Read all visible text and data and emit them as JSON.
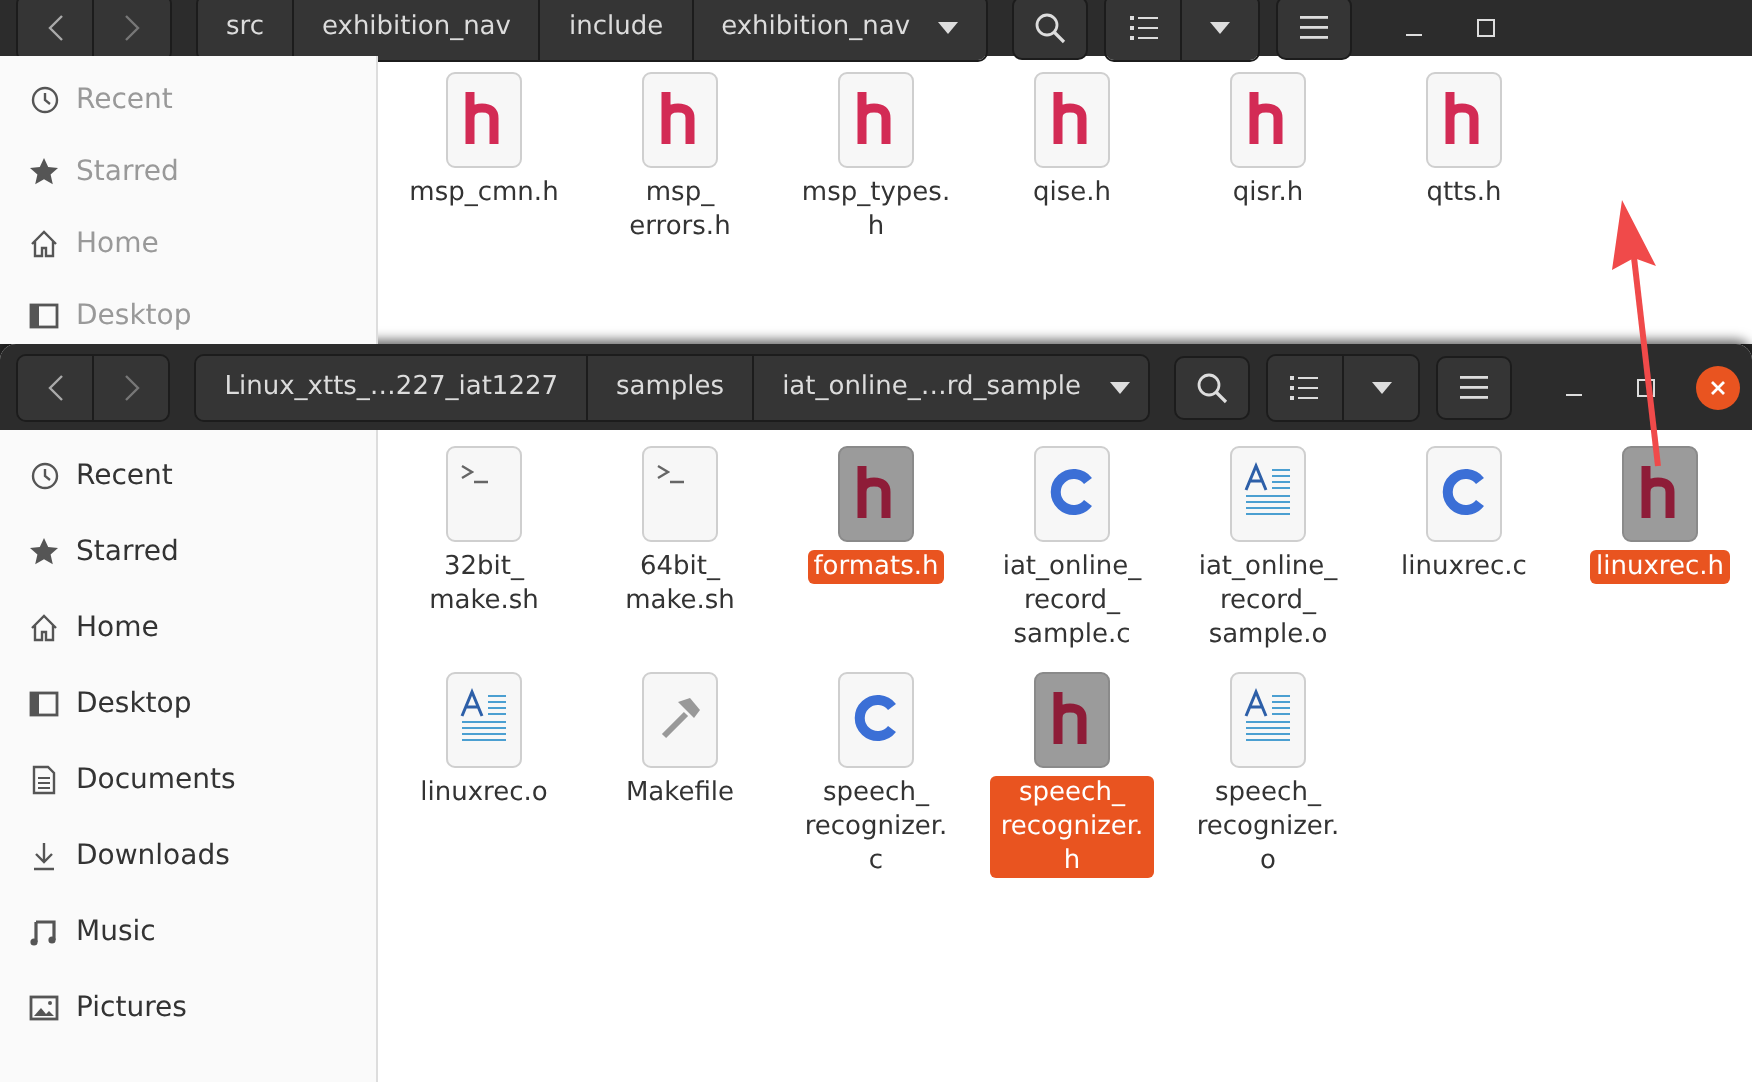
{
  "windows": [
    {
      "path": [
        "src",
        "exhibition_nav",
        "include",
        "exhibition_nav"
      ],
      "close_button": false,
      "sidebar": [
        {
          "label": "Recent",
          "kind": "recent"
        },
        {
          "label": "Starred",
          "kind": "star"
        },
        {
          "label": "Home",
          "kind": "home"
        },
        {
          "label": "Desktop",
          "kind": "desktop"
        }
      ],
      "files": [
        {
          "name": "msp_cmn.h",
          "kind": "h",
          "selected": false
        },
        {
          "name": "msp_errors.h",
          "kind": "h",
          "selected": false
        },
        {
          "name": "msp_types.h",
          "kind": "h",
          "selected": false
        },
        {
          "name": "qise.h",
          "kind": "h",
          "selected": false
        },
        {
          "name": "qisr.h",
          "kind": "h",
          "selected": false
        },
        {
          "name": "qtts.h",
          "kind": "h",
          "selected": false
        }
      ]
    },
    {
      "path": [
        "Linux_xtts_…227_iat1227",
        "samples",
        "iat_online_…rd_sample"
      ],
      "close_button": true,
      "sidebar": [
        {
          "label": "Recent",
          "kind": "recent"
        },
        {
          "label": "Starred",
          "kind": "star"
        },
        {
          "label": "Home",
          "kind": "home"
        },
        {
          "label": "Desktop",
          "kind": "desktop"
        },
        {
          "label": "Documents",
          "kind": "documents"
        },
        {
          "label": "Downloads",
          "kind": "downloads"
        },
        {
          "label": "Music",
          "kind": "music"
        },
        {
          "label": "Pictures",
          "kind": "pictures"
        }
      ],
      "files": [
        {
          "name": "32bit_make.sh",
          "kind": "script",
          "selected": false
        },
        {
          "name": "64bit_make.sh",
          "kind": "script",
          "selected": false
        },
        {
          "name": "formats.h",
          "kind": "h",
          "selected": true
        },
        {
          "name": "iat_online_record_sample.c",
          "kind": "c",
          "selected": false
        },
        {
          "name": "iat_online_record_sample.o",
          "kind": "doc",
          "selected": false
        },
        {
          "name": "linuxrec.c",
          "kind": "c",
          "selected": false
        },
        {
          "name": "linuxrec.h",
          "kind": "h",
          "selected": true
        },
        {
          "name": "linuxrec.o",
          "kind": "doc",
          "selected": false
        },
        {
          "name": "Makefile",
          "kind": "make",
          "selected": false
        },
        {
          "name": "speech_recognizer.c",
          "kind": "c",
          "selected": false
        },
        {
          "name": "speech_recognizer.h",
          "kind": "h",
          "selected": true
        },
        {
          "name": "speech_recognizer.o",
          "kind": "doc",
          "selected": false
        }
      ]
    }
  ]
}
